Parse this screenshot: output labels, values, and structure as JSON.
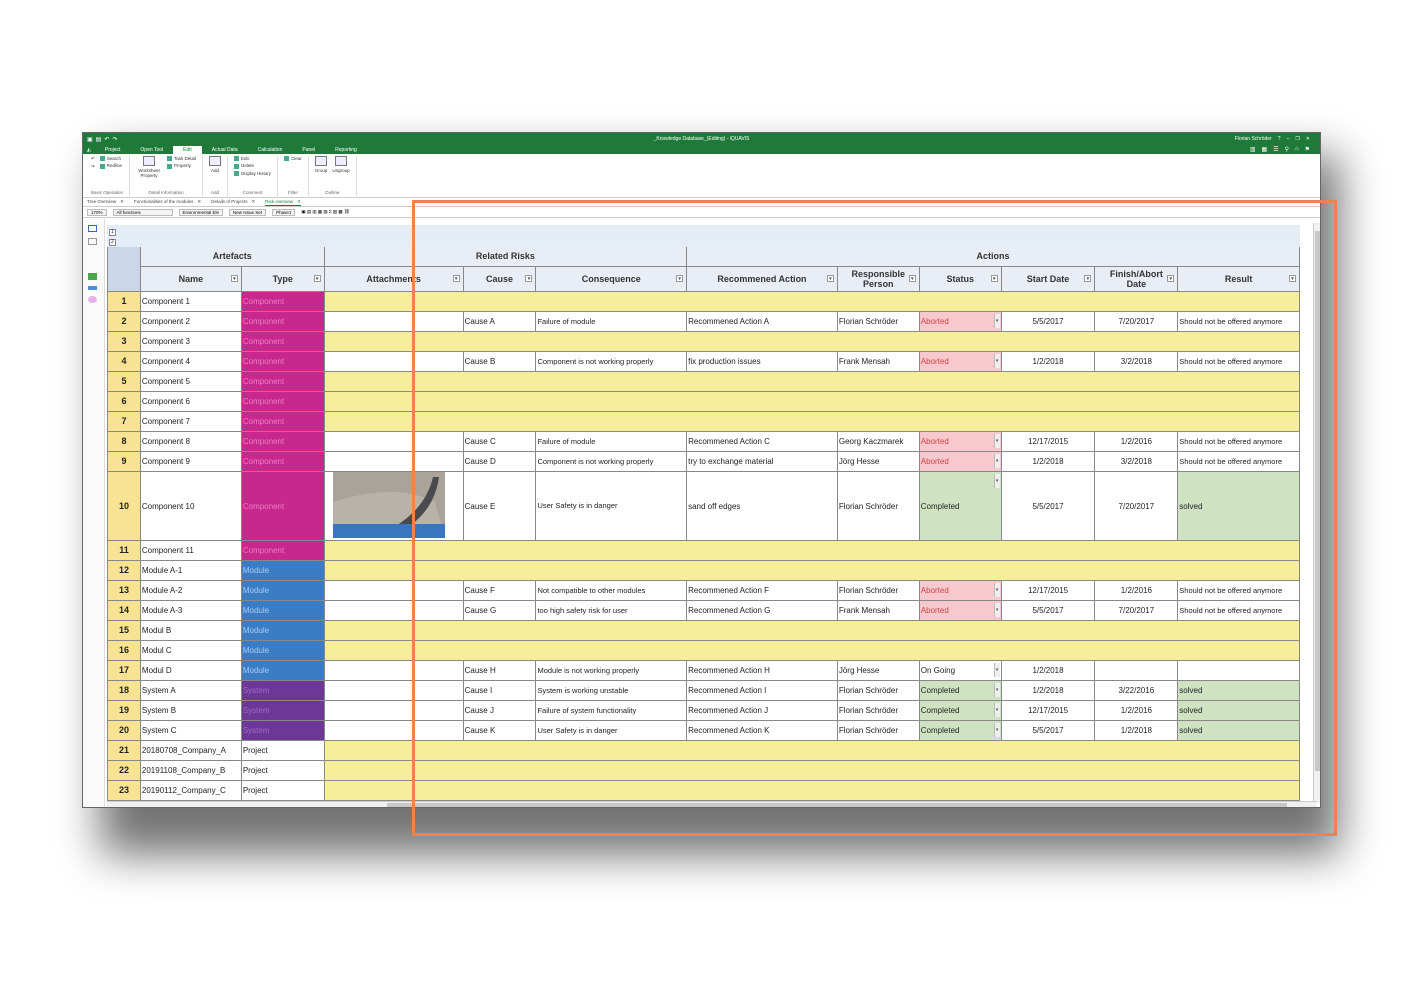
{
  "window": {
    "title": "_Knowledge Database_(Editing) - iQUAVIS",
    "user": "Florian Schröder"
  },
  "menu": [
    "Project",
    "Open Tool",
    "Edit",
    "Actual Data",
    "Calculation",
    "Panel",
    "Reporting"
  ],
  "menu_active": "Edit",
  "ribbon": {
    "basic": {
      "items": [
        "Search",
        "Redline"
      ],
      "label": "Basic Operation"
    },
    "detail": {
      "items": [
        "Worksheet Property",
        "Task Detail",
        "Property"
      ],
      "label": "Detail Information"
    },
    "add": {
      "items": [
        "Add"
      ],
      "label": "Add"
    },
    "comment": {
      "items": [
        "Edit",
        "Delete",
        "Display History"
      ],
      "label": "Comment"
    },
    "filter": {
      "items": [
        "Clear"
      ],
      "label": "Filter"
    },
    "outline": {
      "items": [
        "Group",
        "Ungroup"
      ],
      "label": "Outline"
    }
  },
  "tabs": [
    "Tree Overview",
    "Functionalities of the modules",
    "Details of Projects",
    "Risk overview"
  ],
  "tab_active": "Risk overview",
  "toolbar": {
    "zoom": "170%",
    "functions": "All functions",
    "environment": "Environmental Ele",
    "issue": "New Issue Set",
    "phase": "Phase1"
  },
  "levels": [
    "1",
    "2"
  ],
  "groups": {
    "artefacts": "Artefacts",
    "related_risks": "Related Risks",
    "actions": "Actions"
  },
  "columns": [
    "Name",
    "Type",
    "Attachments",
    "Cause",
    "Consequence",
    "Recommened Action",
    "Responsible Person",
    "Status",
    "Start Date",
    "Finish/Abort Date",
    "Result"
  ],
  "rows": [
    {
      "n": "1",
      "name": "Component 1",
      "type": "Component",
      "t": "pk",
      "f": "y"
    },
    {
      "n": "2",
      "name": "Component 2",
      "type": "Component",
      "t": "pk",
      "f": "w",
      "cause": "Cause A",
      "cons": "Failure of module",
      "rec": "Recommened Action A",
      "resp": "Florian Schröder",
      "status": "Aborted",
      "s": "ab",
      "start": "5/5/2017",
      "fin": "7/20/2017",
      "res": "Should not be offered anymore"
    },
    {
      "n": "3",
      "name": "Component 3",
      "type": "Component",
      "t": "pk",
      "f": "y"
    },
    {
      "n": "4",
      "name": "Component 4",
      "type": "Component",
      "t": "pk",
      "f": "w",
      "cause": "Cause B",
      "cons": "Component is not working properly",
      "rec": "fix production issues",
      "resp": "Frank Mensah",
      "status": "Aborted",
      "s": "ab",
      "start": "1/2/2018",
      "fin": "3/2/2018",
      "res": "Should not be offered anymore"
    },
    {
      "n": "5",
      "name": "Component 5",
      "type": "Component",
      "t": "pk",
      "f": "y"
    },
    {
      "n": "6",
      "name": "Component 6",
      "type": "Component",
      "t": "pk",
      "f": "y"
    },
    {
      "n": "7",
      "name": "Component 7",
      "type": "Component",
      "t": "pk",
      "f": "y"
    },
    {
      "n": "8",
      "name": "Component 8",
      "type": "Component",
      "t": "pk",
      "f": "w",
      "cause": "Cause C",
      "cons": "Failure of module",
      "rec": "Recommened Action C",
      "resp": "Georg Kaczmarek",
      "status": "Aborted",
      "s": "ab",
      "start": "12/17/2015",
      "fin": "1/2/2016",
      "res": "Should not be offered anymore"
    },
    {
      "n": "9",
      "name": "Component 9",
      "type": "Component",
      "t": "pk",
      "f": "w",
      "cause": "Cause D",
      "cons": "Component is not working properly",
      "rec": "try to exchange material",
      "resp": "Jörg Hesse",
      "status": "Aborted",
      "s": "ab",
      "start": "1/2/2018",
      "fin": "3/2/2018",
      "res": "Should not be offered anymore"
    },
    {
      "n": "10",
      "name": "Component 10",
      "type": "Component",
      "t": "pk",
      "f": "w",
      "tall": true,
      "img": true,
      "cause": "Cause E",
      "cons": "User Safety is in danger",
      "rec": "sand off edges",
      "resp": "Florian Schröder",
      "status": "Completed",
      "s": "co",
      "start": "5/5/2017",
      "fin": "7/20/2017",
      "res": "solved"
    },
    {
      "n": "11",
      "name": "Component 11",
      "type": "Component",
      "t": "pk",
      "f": "y"
    },
    {
      "n": "12",
      "name": "Module A-1",
      "type": "Module",
      "t": "bl",
      "f": "y"
    },
    {
      "n": "13",
      "name": "Module A-2",
      "type": "Module",
      "t": "bl",
      "f": "w",
      "cause": "Cause F",
      "cons": "Not compatible to other modules",
      "rec": "Recommened Action F",
      "resp": "Florian Schröder",
      "status": "Aborted",
      "s": "ab",
      "start": "12/17/2015",
      "fin": "1/2/2016",
      "res": "Should not be offered anymore"
    },
    {
      "n": "14",
      "name": "Module A-3",
      "type": "Module",
      "t": "bl",
      "f": "w",
      "cause": "Cause G",
      "cons": "too high safety risk for user",
      "rec": "Recommened Action G",
      "resp": "Frank Mensah",
      "status": "Aborted",
      "s": "ab",
      "start": "5/5/2017",
      "fin": "7/20/2017",
      "res": "Should not be offered anymore"
    },
    {
      "n": "15",
      "name": "Modul B",
      "type": "Module",
      "t": "bl",
      "f": "y"
    },
    {
      "n": "16",
      "name": "Modul C",
      "type": "Module",
      "t": "bl",
      "f": "y"
    },
    {
      "n": "17",
      "name": "Modul D",
      "type": "Module",
      "t": "bl",
      "f": "w",
      "cause": "Cause H",
      "cons": "Module is not working properly",
      "rec": "Recommened Action H",
      "resp": "Jörg Hesse",
      "status": "On Going",
      "s": "w",
      "start": "1/2/2018",
      "fin": "",
      "res": ""
    },
    {
      "n": "18",
      "name": "System A",
      "type": "System",
      "t": "pu",
      "f": "w",
      "cause": "Cause I",
      "cons": "System is working unstable",
      "rec": "Recommened Action I",
      "resp": "Florian Schröder",
      "status": "Completed",
      "s": "co",
      "start": "1/2/2018",
      "fin": "3/22/2016",
      "res": "solved"
    },
    {
      "n": "19",
      "name": "System B",
      "type": "System",
      "t": "pu",
      "f": "w",
      "cause": "Cause J",
      "cons": "Failure of system functionality",
      "rec": "Recommened Action J",
      "resp": "Florian Schröder",
      "status": "Completed",
      "s": "co",
      "start": "12/17/2015",
      "fin": "1/2/2016",
      "res": "solved"
    },
    {
      "n": "20",
      "name": "System C",
      "type": "System",
      "t": "pu",
      "f": "w",
      "cause": "Cause K",
      "cons": "User Safety is in danger",
      "rec": "Recommened Action K",
      "resp": "Florian Schröder",
      "status": "Completed",
      "s": "co",
      "start": "5/5/2017",
      "fin": "1/2/2018",
      "res": "solved"
    },
    {
      "n": "21",
      "name": "20180708_Company_A",
      "type": "Project",
      "t": "w",
      "f": "y"
    },
    {
      "n": "22",
      "name": "20191108_Company_B",
      "type": "Project",
      "t": "w",
      "f": "y"
    },
    {
      "n": "23",
      "name": "20190112_Company_C",
      "type": "Project",
      "t": "w",
      "f": "y"
    }
  ]
}
